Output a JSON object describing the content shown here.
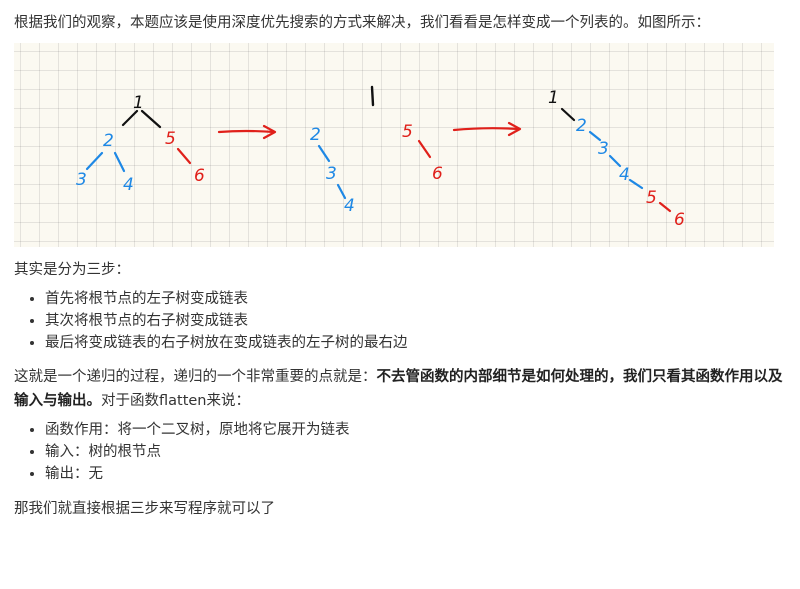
{
  "intro": "根据我们的观察，本题应该是使用深度优先搜索的方式来解决，我们看看是怎样变成一个列表的。如图所示：",
  "figure": {
    "line_black": "#111111",
    "line_blue": "#1e88e5",
    "line_red": "#e0201a",
    "nodes": [
      {
        "id": "n1a",
        "label": "1",
        "color": "#111111"
      },
      {
        "id": "n2a",
        "label": "2",
        "color": "#1e88e5"
      },
      {
        "id": "n3a",
        "label": "3",
        "color": "#1e88e5"
      },
      {
        "id": "n4a",
        "label": "4",
        "color": "#1e88e5"
      },
      {
        "id": "n5a",
        "label": "5",
        "color": "#e0201a"
      },
      {
        "id": "n6a",
        "label": "6",
        "color": "#e0201a"
      },
      {
        "id": "n1b",
        "label": "1",
        "color": "#111111"
      },
      {
        "id": "n2b",
        "label": "2",
        "color": "#1e88e5"
      },
      {
        "id": "n3b",
        "label": "3",
        "color": "#1e88e5"
      },
      {
        "id": "n4b",
        "label": "4",
        "color": "#1e88e5"
      },
      {
        "id": "n5b",
        "label": "5",
        "color": "#e0201a"
      },
      {
        "id": "n6b",
        "label": "6",
        "color": "#e0201a"
      },
      {
        "id": "n1c",
        "label": "1",
        "color": "#111111"
      },
      {
        "id": "n2c",
        "label": "2",
        "color": "#1e88e5"
      },
      {
        "id": "n3c",
        "label": "3",
        "color": "#1e88e5"
      },
      {
        "id": "n4c",
        "label": "4",
        "color": "#1e88e5"
      },
      {
        "id": "n5c",
        "label": "5",
        "color": "#e0201a"
      },
      {
        "id": "n6c",
        "label": "6",
        "color": "#e0201a"
      }
    ]
  },
  "steps_intro": "其实是分为三步：",
  "steps": [
    "首先将根节点的左子树变成链表",
    "其次将根节点的右子树变成链表",
    "最后将变成链表的右子树放在变成链表的左子树的最右边"
  ],
  "recursion": {
    "lead": "这就是一个递归的过程，递归的一个非常重要的点就是：",
    "bold": "不去管函数的内部细节是如何处理的，我们只看其函数作用以及输入与输出。",
    "tail": "对于函数flatten来说："
  },
  "func_items": [
    "函数作用：将一个二叉树，原地将它展开为链表",
    "输入：树的根节点",
    "输出：无"
  ],
  "closing": "那我们就直接根据三步来写程序就可以了"
}
